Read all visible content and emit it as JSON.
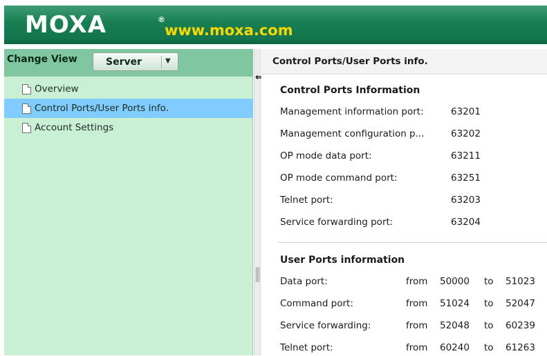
{
  "header": {
    "logo": "MOXA",
    "registered_mark": "®",
    "url": "www.moxa.com"
  },
  "left_panel": {
    "change_view_label": "Change View",
    "view_select": {
      "value": "Server",
      "arrow_icon": "dropdown-arrow-icon"
    },
    "nav_items": [
      {
        "label": "Overview",
        "icon": "document-icon",
        "selected": false
      },
      {
        "label": "Control Ports/User Ports info.",
        "icon": "document-icon",
        "selected": true
      },
      {
        "label": "Account Settings",
        "icon": "document-icon",
        "selected": false
      }
    ]
  },
  "right_panel": {
    "title": "Control Ports/User Ports info.",
    "control_section": {
      "title": "Control Ports Information",
      "rows": [
        {
          "label": "Management information port:",
          "value": "63201"
        },
        {
          "label": "Management configuration p...",
          "value": "63202"
        },
        {
          "label": "OP mode data port:",
          "value": "63211"
        },
        {
          "label": "OP mode command port:",
          "value": "63251"
        },
        {
          "label": "Telnet port:",
          "value": "63203"
        },
        {
          "label": "Service forwarding port:",
          "value": "63204"
        }
      ]
    },
    "user_section": {
      "title": "User Ports information",
      "from_label": "from",
      "to_label": "to",
      "rows": [
        {
          "label": "Data port:",
          "from": "50000",
          "to": "51023"
        },
        {
          "label": "Command port:",
          "from": "51024",
          "to": "52047"
        },
        {
          "label": "Service forwarding:",
          "from": "52048",
          "to": "60239"
        },
        {
          "label": "Telnet port:",
          "from": "60240",
          "to": "61263"
        }
      ]
    }
  },
  "colors": {
    "header_green": "#12744a",
    "url_yellow": "#ffd800",
    "left_bg": "#c9f0d4",
    "toolbar_green": "#7fc6a1",
    "selected_blue": "#80ccff"
  }
}
